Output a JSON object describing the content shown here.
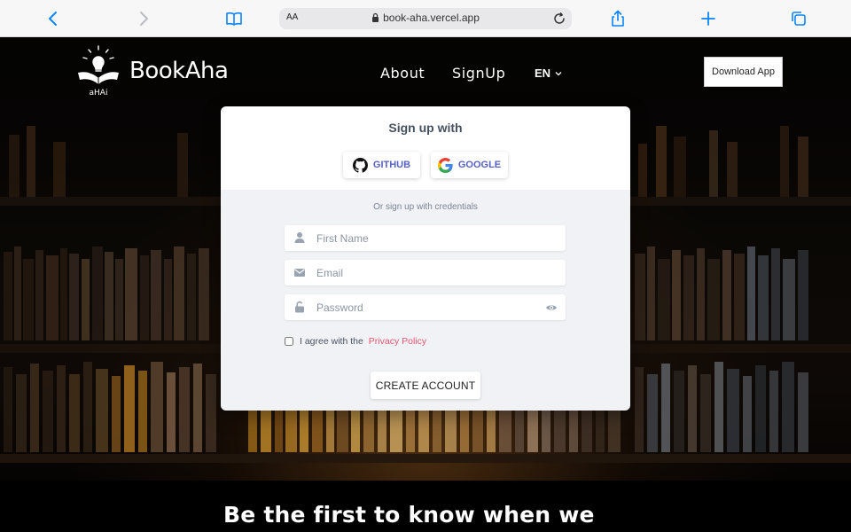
{
  "browser": {
    "text_size_label": "AA",
    "url": "book-aha.vercel.app"
  },
  "nav": {
    "brand": "BookAha",
    "brand_mark": "aHAi",
    "links": [
      "About",
      "SignUp"
    ],
    "language": "EN",
    "download_label": "Download App"
  },
  "signup": {
    "title": "Sign up with",
    "github_label": "GITHUB",
    "google_label": "GOOGLE",
    "or_text": "Or sign up with credentials",
    "first_name_placeholder": "First Name",
    "email_placeholder": "Email",
    "password_placeholder": "Password",
    "agree_text": "I agree with the",
    "policy_link": "Privacy Policy",
    "submit_label": "CREATE ACCOUNT"
  },
  "headline": "Be the first to know when we",
  "colors": {
    "accent_link": "#e05770",
    "social_text": "#5662c4",
    "browser_blue": "#0a84ff"
  }
}
